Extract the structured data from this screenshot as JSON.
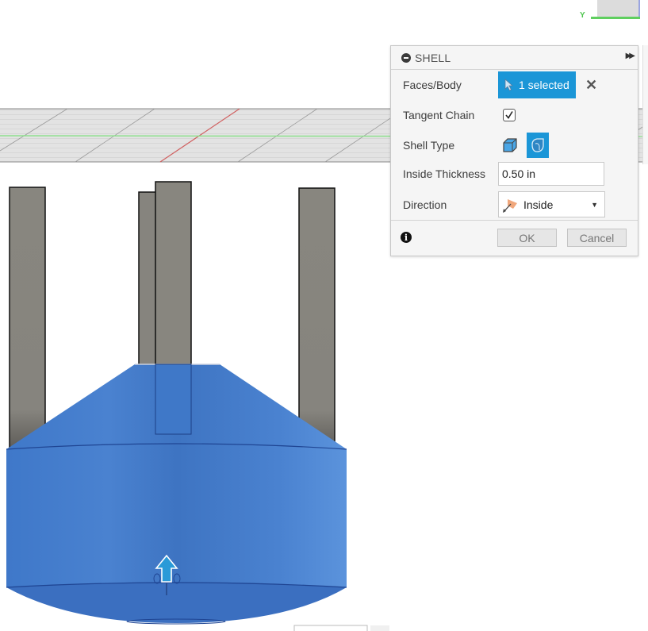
{
  "dialog": {
    "title": "SHELL",
    "header_icon": "minus-circle-icon",
    "expand_icon": "double-chevron-right-icon",
    "rows": {
      "faces_body": {
        "label": "Faces/Body",
        "selection_text": "1 selected",
        "selection_icon": "cursor-arrow-icon",
        "clear_icon": "close-icon"
      },
      "tangent_chain": {
        "label": "Tangent Chain",
        "checked": true
      },
      "shell_type": {
        "label": "Shell Type",
        "options": [
          "sharp-shell",
          "rounded-shell"
        ],
        "selected": "rounded-shell"
      },
      "inside_thickness": {
        "label": "Inside Thickness",
        "value": "0.50 in"
      },
      "direction": {
        "label": "Direction",
        "value": "Inside",
        "icon": "direction-flag-icon"
      }
    },
    "info_icon": "info-icon",
    "ok_label": "OK",
    "cancel_label": "Cancel"
  },
  "viewcube": {
    "axis_label": "Y"
  },
  "colors": {
    "accent": "#1b96d7",
    "body_blue": "#4a7fcf",
    "post_gray": "#87857f",
    "grid_red_axis": "#d06060",
    "grid_green_axis": "#8ee08e"
  }
}
